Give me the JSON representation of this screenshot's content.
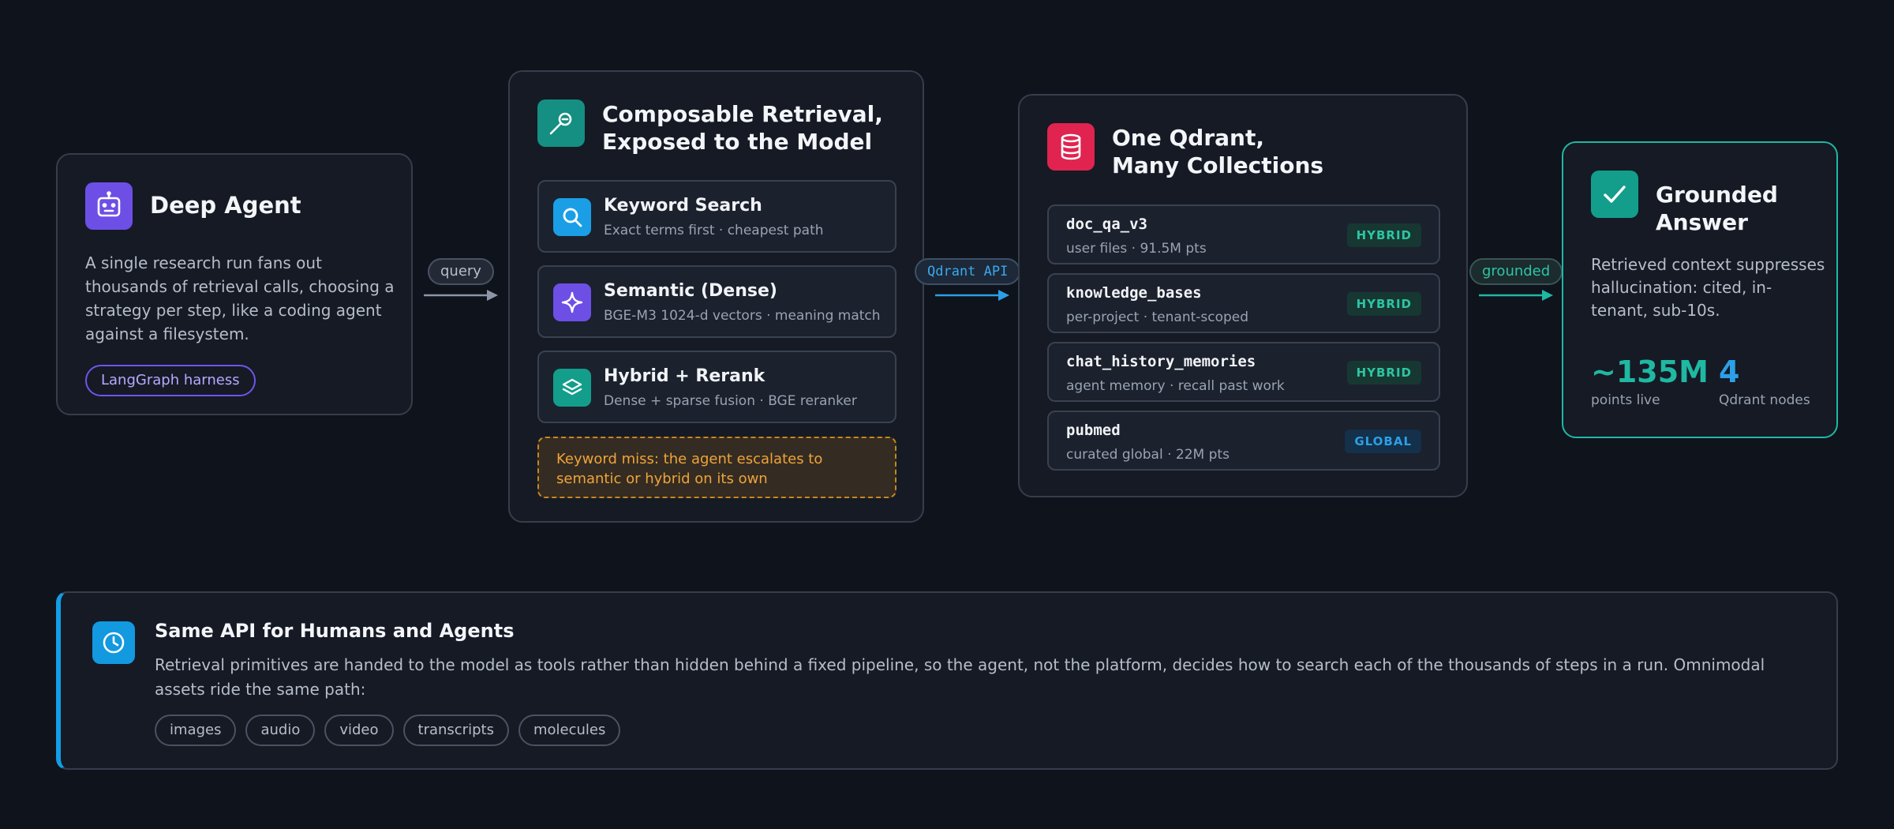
{
  "agent": {
    "title": "Deep Agent",
    "description": "A single research run fans out thousands of retrieval calls, choosing a strategy per step, like a coding agent against a filesystem.",
    "tag": "LangGraph harness"
  },
  "connectors": {
    "query": "query",
    "api": "Qdrant API",
    "grounded": "grounded"
  },
  "retrieval": {
    "title_line1": "Composable Retrieval,",
    "title_line2": "Exposed to the Model",
    "tools": [
      {
        "name": "Keyword Search",
        "subtitle": "Exact terms first · cheapest path",
        "icon": "search-icon",
        "color": "#1a9fe6"
      },
      {
        "name": "Semantic (Dense)",
        "subtitle": "BGE-M3 1024-d vectors · meaning match",
        "icon": "sparkle-icon",
        "color": "#6d4fe6"
      },
      {
        "name": "Hybrid + Rerank",
        "subtitle": "Dense + sparse fusion · BGE reranker",
        "icon": "layers-icon",
        "color": "#139e8c"
      }
    ],
    "warning": "Keyword miss: the agent escalates to semantic or hybrid on its own"
  },
  "qdrant": {
    "title_line1": "One Qdrant,",
    "title_line2": "Many Collections",
    "collections": [
      {
        "name": "doc_qa_v3",
        "subtitle": "user files · 91.5M pts",
        "badge": "HYBRID"
      },
      {
        "name": "knowledge_bases",
        "subtitle": "per-project · tenant-scoped",
        "badge": "HYBRID"
      },
      {
        "name": "chat_history_memories",
        "subtitle": "agent memory · recall past work",
        "badge": "HYBRID"
      },
      {
        "name": "pubmed",
        "subtitle": "curated global · 22M pts",
        "badge": "GLOBAL"
      }
    ]
  },
  "grounded": {
    "title_line1": "Grounded",
    "title_line2": "Answer",
    "description": "Retrieved context suppresses hallucination: cited, in-tenant, sub-10s.",
    "stats": [
      {
        "value": "~135M",
        "label": "points live"
      },
      {
        "value": "4",
        "label": "Qdrant nodes"
      }
    ]
  },
  "bottom": {
    "title": "Same API for Humans and Agents",
    "description": "Retrieval primitives are handed to the model as tools rather than hidden behind a fixed pipeline, so the agent, not the platform, decides how to search each of the thousands of steps in a run. Omnimodal assets ride the same path:",
    "tags": [
      "images",
      "audio",
      "video",
      "transcripts",
      "molecules"
    ]
  },
  "colors": {
    "agent": "#6d4fe6",
    "retrieval": "#148f82",
    "qdrant": "#e0244f",
    "grounded": "#1fb8a2",
    "api": "#2c9fe6",
    "warning": "#f0a33a"
  }
}
